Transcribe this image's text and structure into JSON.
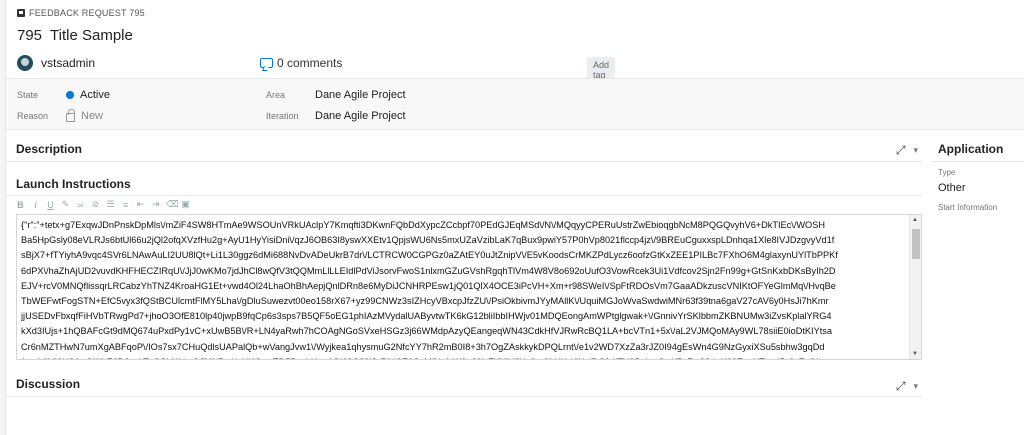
{
  "header": {
    "type_label": "FEEDBACK REQUEST 795",
    "id": "795",
    "title": "Title Sample",
    "assigned_to": "vstsadmin",
    "comments": "0 comments",
    "add_tag": "Add tag"
  },
  "fields": {
    "state_label": "State",
    "state_value": "Active",
    "reason_label": "Reason",
    "reason_value": "New",
    "area_label": "Area",
    "area_value": "Dane Agile Project",
    "iteration_label": "Iteration",
    "iteration_value": "Dane Agile Project"
  },
  "sections": {
    "description": "Description",
    "launch_instructions": "Launch Instructions",
    "discussion": "Discussion"
  },
  "editor": {
    "lines": [
      "{\"r\":\"+tetx+g7ExqwJDnPnskDpMls\\/mZiF4SW8HTmAe9WSOUnVRkUAclpY7Kmqfti3DKwnFQbDdXypcZCcbpf70PEdGJEqMSd\\/N\\/MQqyyCPERuUstrZwEbioqgbNcM8PQGQvyhV6+DkTIEc\\/WOSH",
      "Ba5HpGsly08eVLRJs6btUl66u2jQl2ofqXVzfHu2g+AyU1HyYisiDni\\/qzJ6OB63I8yswXXEtv1QpjsWU6Ns5mxUZaVzibLaK7qBux9pwiY57P0hVp8021flccp4jz\\/9BREuCguxxspLDnhqa1Xle8IVJDzgvyVd1f",
      "sBjX7+fTYiyhA9vqc4SVr6LNAwAuLI2UU8lQt+Li1L30ggz6dMi688NvDvADeUkrB7dr\\/LCTRCW0CGPGz0aZAtEY0uJtZnipV\\/E5vKoodsCrMKZPdLycz6oofzGtKxZEE1PILBc7FXhO6M4glaxynUYlTbPPKf",
      "6dPX\\/haZhAjUD2vuvdKHFHECZIRqU\\/JjJ0wKMo7jdJhCl8wQfV3tQQMmLlLLEIdlPdViJsorvFwoS1nlxmGZuGVshRgqhTlVm4W8V8o692oUufO3VowRcek3Ui1Vdfcov2Sjn2Fn99g+GtSnKxbDKsByIh2D",
      "EJV+rcV0MNQflissqrLRCabzYhTNZ4KroaHG1Et+vwd4Ol24LhaOhBhAepjQnlDRn8e6MyDiJCNHRPEsw1jQ01QlX4OCE3iPcVH+Xm+r98SWeI\\/SpFtRDOsVm7GaaADkzuscVNIKtOFYeGlmMq\\/HvqBe",
      "TbWEFwtFogSTN+EfC5vyx3fQStBCUlcmtFlMY5Lha\\/gDluSuwezvt00eo158rX67+yz99CNWz3sIZHcyVBxcpJfzZU\\/PsiOkbivmJYyMAllK\\/UquiMGJoWvaSwdwiMNr63f39tna6gaV27cAV6y0HsJi7hKmr",
      "jjUSEDvFbxqfFiHVbTRwgPd7+jhoO3OfE810lp40jwpB9fqCp6s3sps7B5QF5oEG1phIAzMVydalUAByvtwTK6kG12bliIbbIHWjv01MDQEongAmWPtglgwak+\\/GnnivYrSKlbbmZKBNUMw3iZvsKplalYRG4",
      "kXd3IUjs+1hQBAFcGt9dMQ674uPxdPy1vC+xUwB5B\\/R+LN4yaRwh7hCOAgNGoSVxeHSGz3j66WMdpAzyQEangeqWN43CdkHfVJRwRcBQ1LA+bcVTn1+5x\\/aL2VJMQoMAy9WL78siiE0ioDtKIYtsa",
      "Cr6nMZTHwN7umXgABFqoP\\/IOs7sx7CHuQdlsUAPalQb+wVangJvw1\\/Wyjkea1qhysmuG2NfcYY7hR2mB0I8+3h7OgZAskkykDPQLrnt\\/e1v2WD7XzZa3rJZ0I94gEsWn4G9NzGyxiXSu5sbhw3gqDd",
      "1xv4dik90U8A+QWhE6D3yyjtToGSLNLksQJMNBm\\/cXHQryrED5BzyhHnp1OI99C89iJzPlkiCFASyMfUsfzW9o93iy7XVjUJUg9qt2fd4\\/v\\/lKaiDC9dfFV3PsIeaOw\\/Bz7yt93d+V62EgoYTzqdBr0vEofKm"
    ]
  },
  "side": {
    "title": "Application",
    "type_label": "Type",
    "type_value": "Other",
    "start_label": "Start Information"
  }
}
